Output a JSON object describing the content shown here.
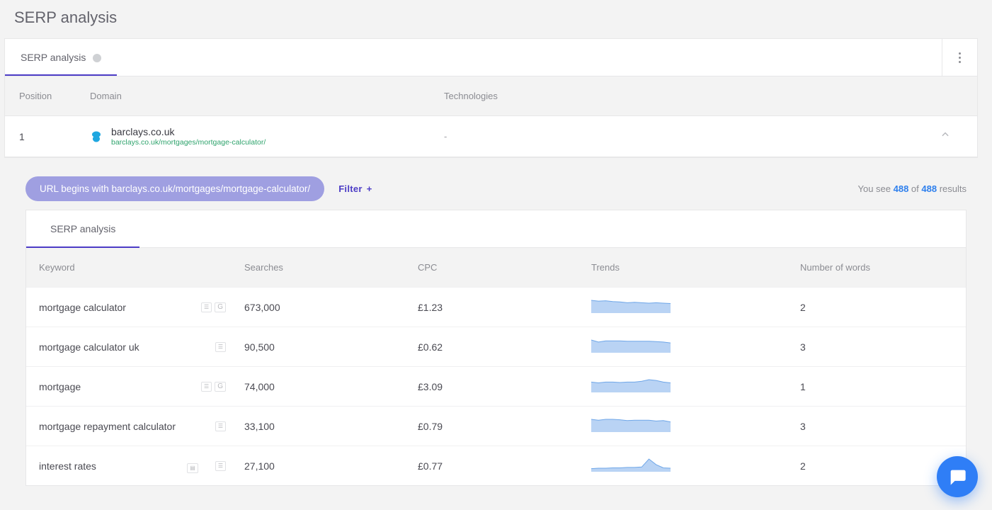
{
  "page_title": "SERP analysis",
  "outer_card": {
    "tab_label": "SERP analysis",
    "columns": {
      "position": "Position",
      "domain": "Domain",
      "technologies": "Technologies"
    },
    "row": {
      "position": "1",
      "domain": "barclays.co.uk",
      "url": "barclays.co.uk/mortgages/mortgage-calculator/",
      "technologies": "-"
    }
  },
  "filters": {
    "chip_label": "URL begins with barclays.co.uk/mortgages/mortgage-calculator/",
    "filter_label": "Filter",
    "summary_prefix": "You see ",
    "summary_of": " of  ",
    "summary_suffix": " results",
    "visible_count": "488",
    "total_count": "488"
  },
  "inner_card": {
    "tab_label": "SERP analysis",
    "columns": {
      "keyword": "Keyword",
      "searches": "Searches",
      "cpc": "CPC",
      "trends": "Trends",
      "words": "Number of words"
    },
    "rows": [
      {
        "keyword": "mortgage calculator",
        "searches": "673,000",
        "cpc": "£1.23",
        "words": "2",
        "badges": [
          "dash",
          "gg"
        ],
        "spark": [
          30,
          28,
          29,
          27,
          26,
          24,
          25,
          24,
          23,
          24,
          23,
          22
        ]
      },
      {
        "keyword": "mortgage calculator uk",
        "searches": "90,500",
        "cpc": "£0.62",
        "words": "3",
        "badges": [
          "dash"
        ],
        "spark": [
          29,
          24,
          27,
          27,
          27,
          26,
          26,
          26,
          26,
          25,
          24,
          22
        ]
      },
      {
        "keyword": "mortgage",
        "searches": "74,000",
        "cpc": "£3.09",
        "words": "1",
        "badges": [
          "dash",
          "gg"
        ],
        "spark": [
          24,
          22,
          24,
          24,
          23,
          24,
          24,
          26,
          30,
          28,
          24,
          22
        ]
      },
      {
        "keyword": "mortgage repayment calculator",
        "searches": "33,100",
        "cpc": "£0.79",
        "words": "3",
        "badges": [
          "dash"
        ],
        "spark": [
          28,
          26,
          28,
          28,
          27,
          25,
          26,
          26,
          26,
          24,
          25,
          22
        ]
      },
      {
        "keyword": "interest rates",
        "searches": "27,100",
        "cpc": "£0.77",
        "words": "2",
        "badges": [
          "card",
          "dash"
        ],
        "spark": [
          6,
          7,
          7,
          8,
          8,
          9,
          9,
          10,
          30,
          16,
          8,
          7
        ]
      }
    ]
  }
}
